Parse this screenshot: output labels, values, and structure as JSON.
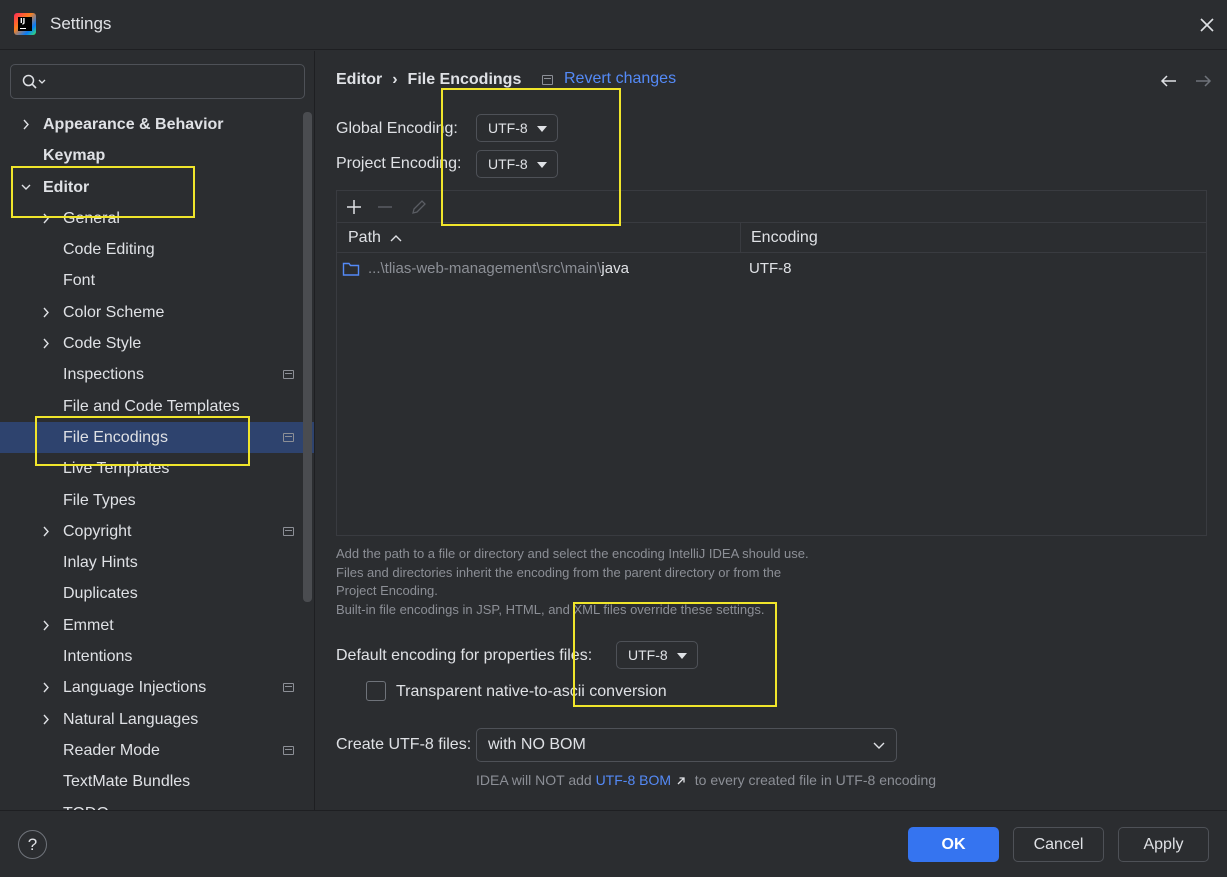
{
  "window": {
    "title": "Settings"
  },
  "search": {
    "placeholder": ""
  },
  "tree": {
    "items": [
      {
        "label": "Appearance & Behavior",
        "bold": true,
        "expandable": true,
        "expanded": false,
        "level": 0,
        "project_icon": false
      },
      {
        "label": "Keymap",
        "bold": true,
        "expandable": false,
        "level": 0,
        "project_icon": false
      },
      {
        "label": "Editor",
        "bold": true,
        "expandable": true,
        "expanded": true,
        "level": 0,
        "project_icon": false
      },
      {
        "label": "General",
        "bold": false,
        "expandable": true,
        "expanded": false,
        "level": 1,
        "project_icon": false
      },
      {
        "label": "Code Editing",
        "bold": false,
        "expandable": false,
        "level": 1,
        "project_icon": false
      },
      {
        "label": "Font",
        "bold": false,
        "expandable": false,
        "level": 1,
        "project_icon": false
      },
      {
        "label": "Color Scheme",
        "bold": false,
        "expandable": true,
        "expanded": false,
        "level": 1,
        "project_icon": false
      },
      {
        "label": "Code Style",
        "bold": false,
        "expandable": true,
        "expanded": false,
        "level": 1,
        "project_icon": false
      },
      {
        "label": "Inspections",
        "bold": false,
        "expandable": false,
        "level": 1,
        "project_icon": true
      },
      {
        "label": "File and Code Templates",
        "bold": false,
        "expandable": false,
        "level": 1,
        "project_icon": false
      },
      {
        "label": "File Encodings",
        "bold": false,
        "expandable": false,
        "level": 1,
        "project_icon": true,
        "selected": true
      },
      {
        "label": "Live Templates",
        "bold": false,
        "expandable": false,
        "level": 1,
        "project_icon": false
      },
      {
        "label": "File Types",
        "bold": false,
        "expandable": false,
        "level": 1,
        "project_icon": false
      },
      {
        "label": "Copyright",
        "bold": false,
        "expandable": true,
        "expanded": false,
        "level": 1,
        "project_icon": true
      },
      {
        "label": "Inlay Hints",
        "bold": false,
        "expandable": false,
        "level": 1,
        "project_icon": false
      },
      {
        "label": "Duplicates",
        "bold": false,
        "expandable": false,
        "level": 1,
        "project_icon": false
      },
      {
        "label": "Emmet",
        "bold": false,
        "expandable": true,
        "expanded": false,
        "level": 1,
        "project_icon": false
      },
      {
        "label": "Intentions",
        "bold": false,
        "expandable": false,
        "level": 1,
        "project_icon": false
      },
      {
        "label": "Language Injections",
        "bold": false,
        "expandable": true,
        "expanded": false,
        "level": 1,
        "project_icon": true
      },
      {
        "label": "Natural Languages",
        "bold": false,
        "expandable": true,
        "expanded": false,
        "level": 1,
        "project_icon": false
      },
      {
        "label": "Reader Mode",
        "bold": false,
        "expandable": false,
        "level": 1,
        "project_icon": true
      },
      {
        "label": "TextMate Bundles",
        "bold": false,
        "expandable": false,
        "level": 1,
        "project_icon": false
      },
      {
        "label": "TODO",
        "bold": false,
        "expandable": false,
        "level": 1,
        "project_icon": false
      }
    ]
  },
  "breadcrumb": {
    "parent": "Editor",
    "separator": "›",
    "current": "File Encodings"
  },
  "revert": {
    "label": "Revert changes"
  },
  "encoding": {
    "global_label": "Global Encoding:",
    "global_value": "UTF-8",
    "project_label": "Project Encoding:",
    "project_value": "UTF-8"
  },
  "table": {
    "col_path": "Path",
    "col_encoding": "Encoding",
    "rows": [
      {
        "path_prefix": "...\\tlias-web-management\\src\\main\\",
        "path_name": "java",
        "encoding": "UTF-8"
      }
    ]
  },
  "hint": {
    "line1": "Add the path to a file or directory and select the encoding IntelliJ IDEA should use.",
    "line2": "Files and directories inherit the encoding from the parent directory or from the",
    "line3": "Project Encoding.",
    "line4": "Built-in file encodings in JSP, HTML, and XML files override these settings."
  },
  "properties": {
    "label": "Default encoding for properties files:",
    "value": "UTF-8",
    "checkbox_label": "Transparent native-to-ascii conversion",
    "checked": false
  },
  "bom": {
    "label": "Create UTF-8 files:",
    "value": "with NO BOM",
    "note_prefix": "IDEA will NOT add",
    "note_link": "UTF-8 BOM",
    "note_suffix": "to every created file in UTF-8 encoding"
  },
  "buttons": {
    "help": "?",
    "ok": "OK",
    "cancel": "Cancel",
    "apply": "Apply"
  },
  "colors": {
    "accent": "#3574f0",
    "link": "#548af7",
    "selection": "#2e436e",
    "annotation": "#f0e52b",
    "background": "#2b2d30"
  }
}
